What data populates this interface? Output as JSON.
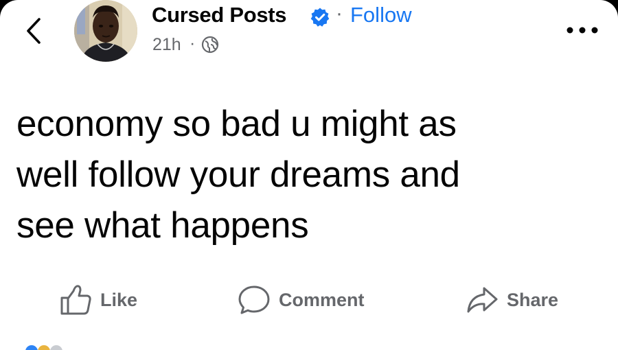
{
  "header": {
    "page_name": "Cursed Posts",
    "separator": "·",
    "follow_label": "Follow",
    "time": "21h",
    "time_separator": "·",
    "back_icon": "chevron-left-icon",
    "verified_icon": "verified-badge-icon",
    "privacy_icon": "globe-icon",
    "more_icon": "more-dots-icon"
  },
  "post": {
    "lines": [
      "economy so bad u might as",
      "well follow your dreams and",
      "see what happens"
    ]
  },
  "actions": {
    "like_label": "Like",
    "comment_label": "Comment",
    "share_label": "Share"
  },
  "colors": {
    "link_blue": "#1877f2",
    "secondary_gray": "#65676b",
    "text_dark": "#050505"
  }
}
